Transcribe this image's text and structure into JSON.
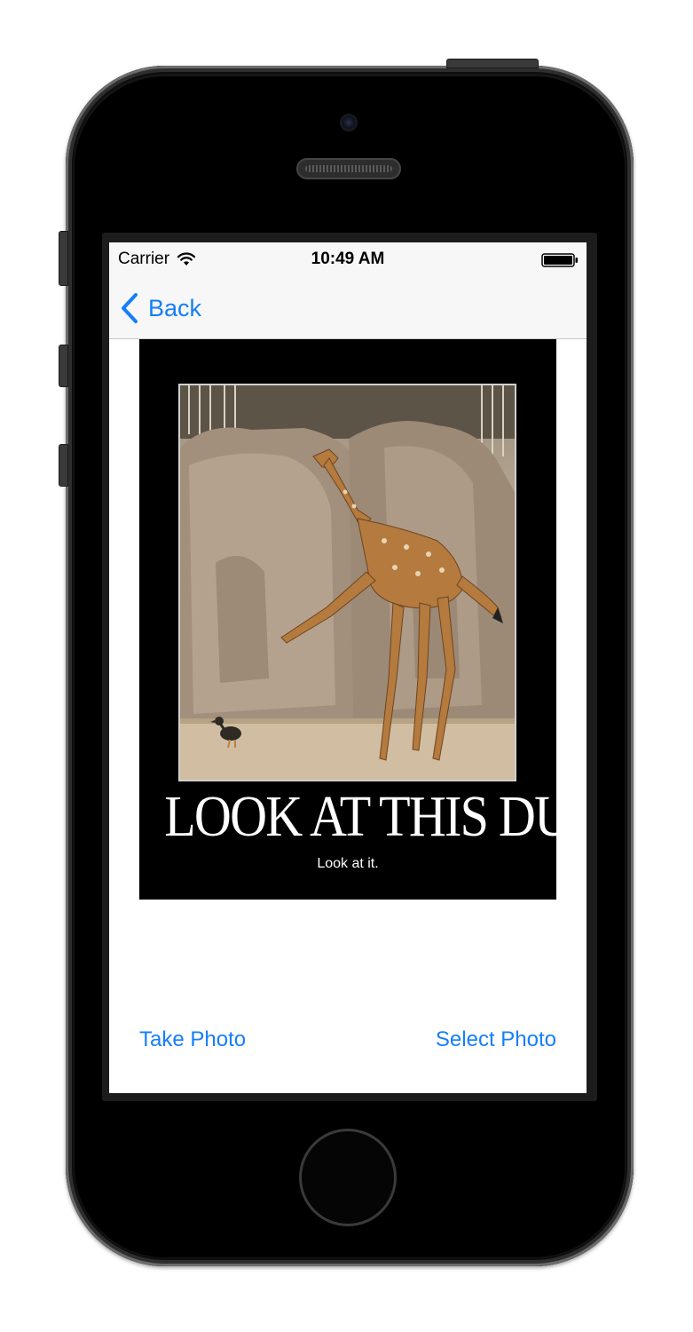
{
  "status_bar": {
    "carrier": "Carrier",
    "time": "10:49 AM",
    "wifi_icon": "wifi-icon",
    "battery_icon": "battery-icon"
  },
  "nav_bar": {
    "back_label": "Back",
    "back_icon": "chevron-left-icon"
  },
  "photo": {
    "headline": "LOOK AT THIS DUCK",
    "caption": "Look at it."
  },
  "actions": {
    "take_photo_label": "Take Photo",
    "select_photo_label": "Select Photo"
  },
  "colors": {
    "tint": "#157efb",
    "bar_background": "#f7f7f7",
    "device_body": "#151515"
  }
}
